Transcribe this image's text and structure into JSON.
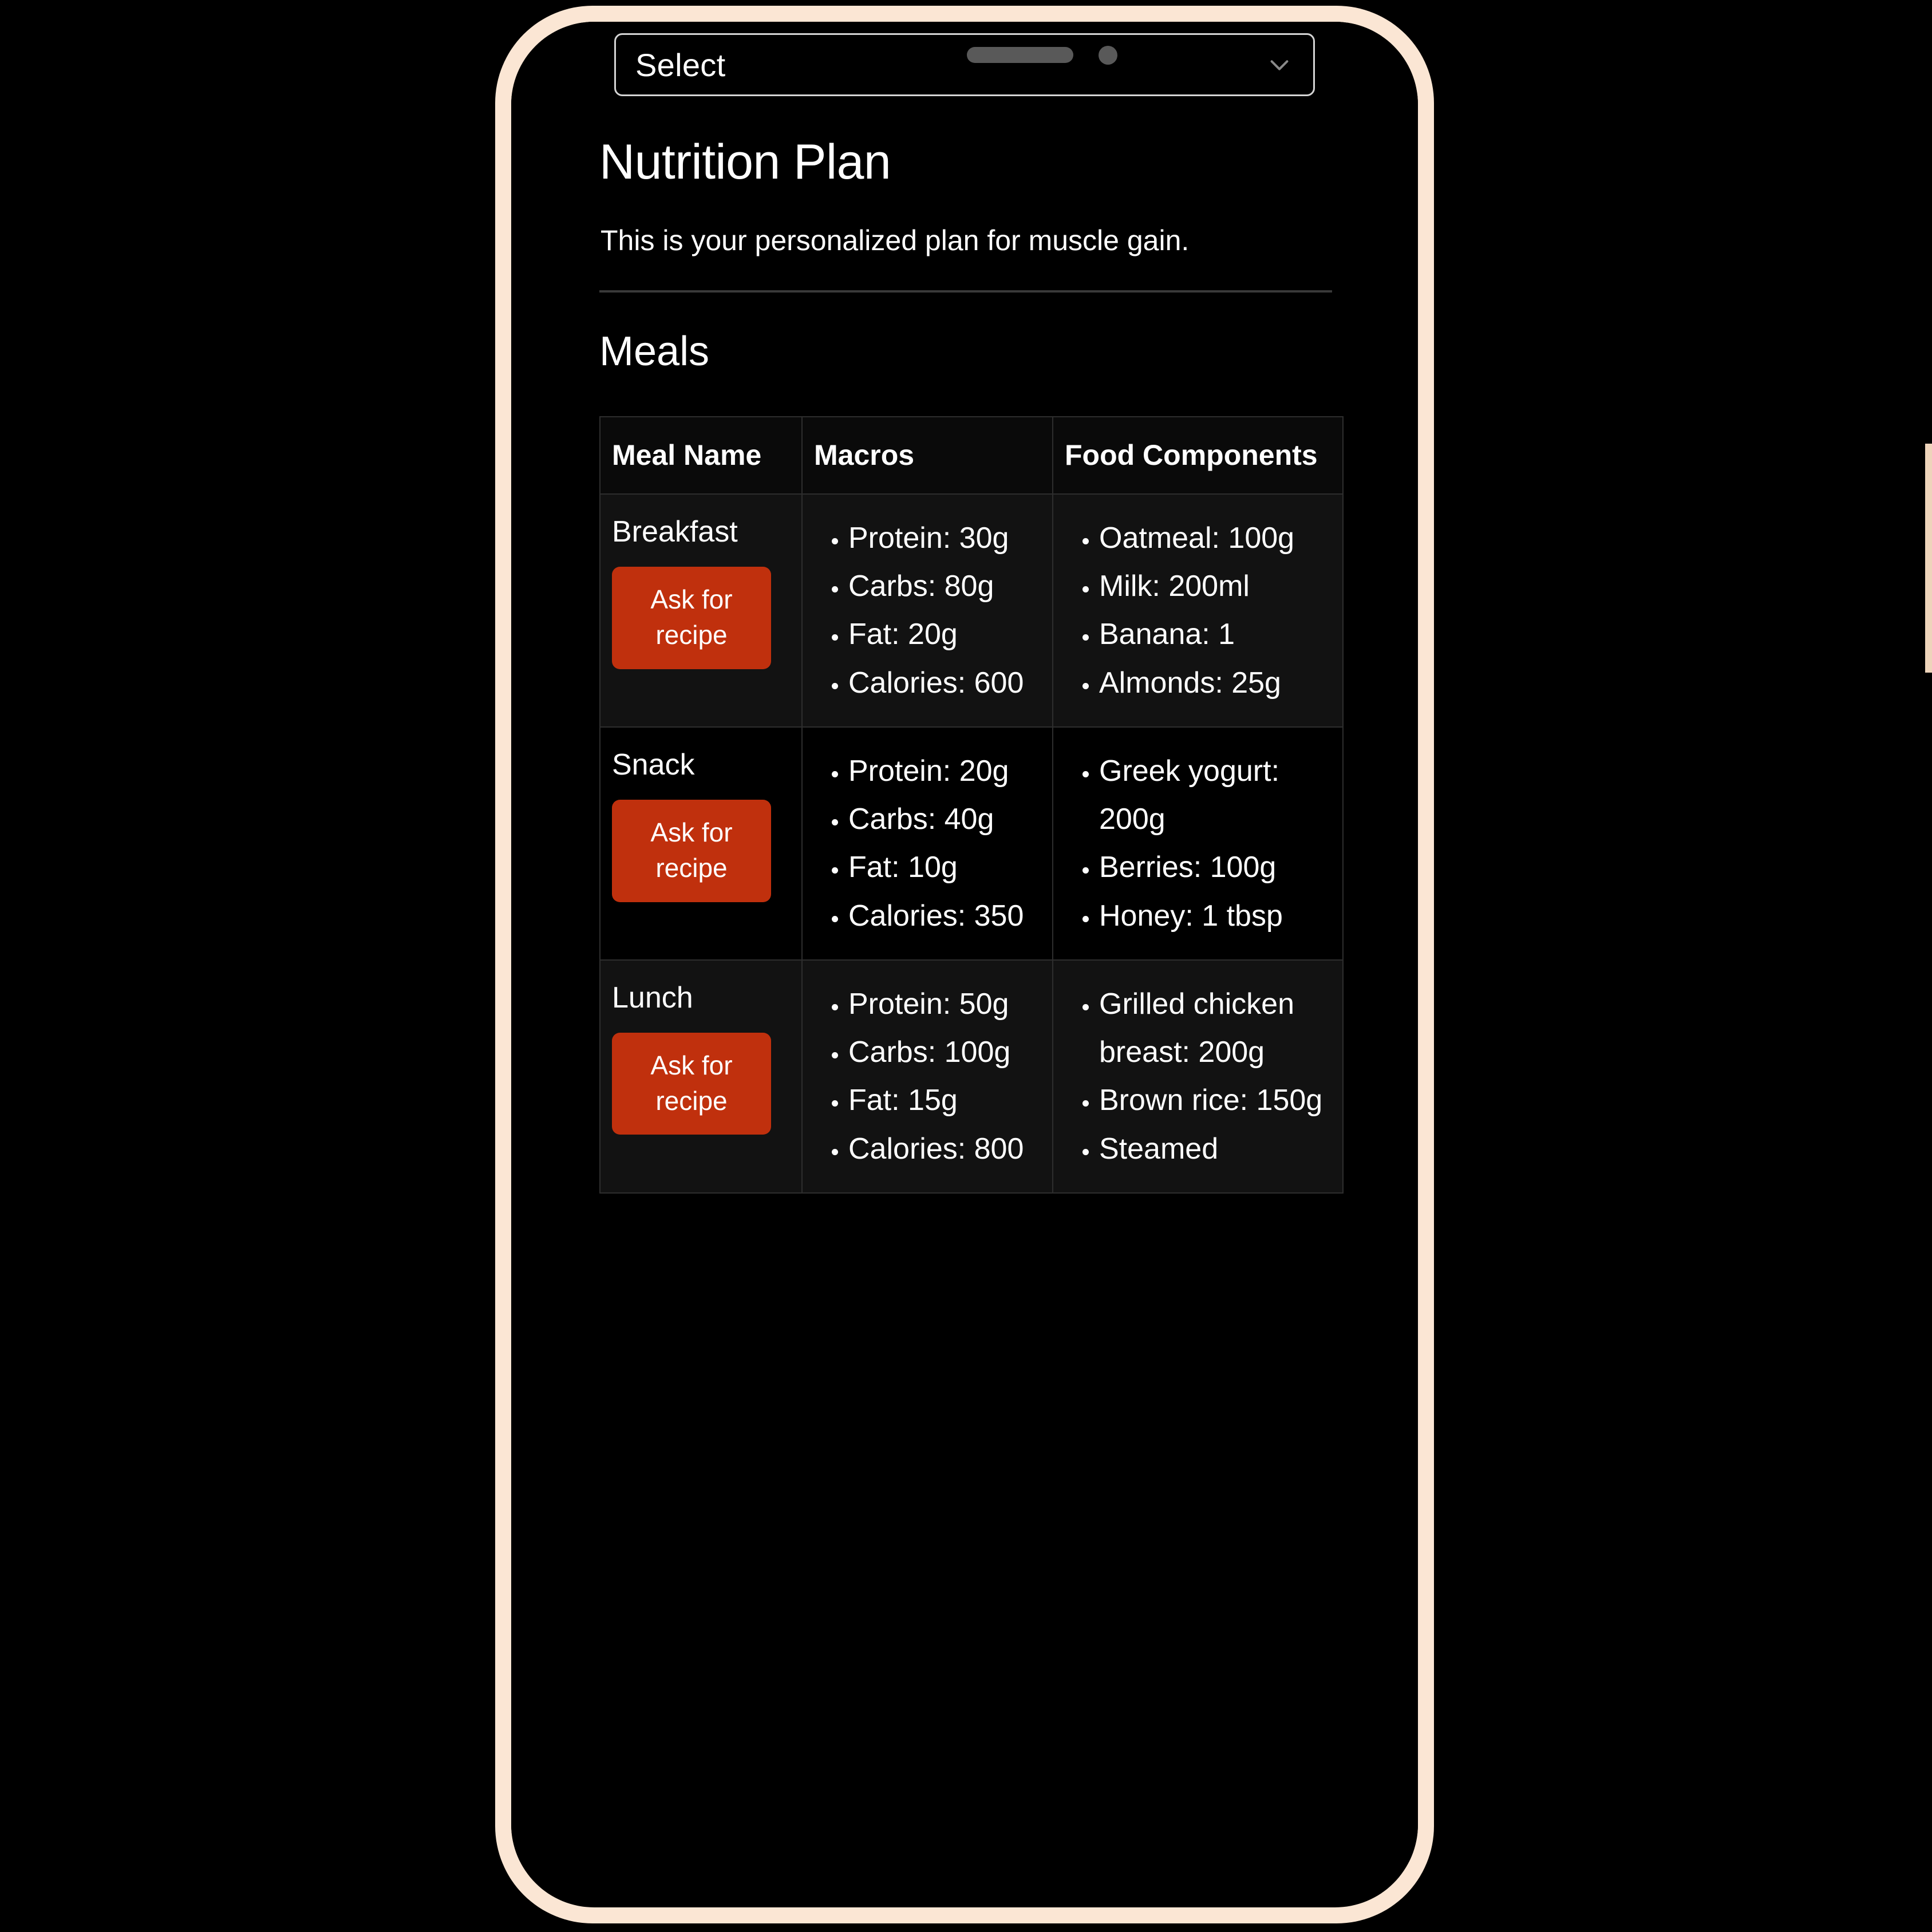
{
  "device": {
    "frame_color": "#fbe6d4",
    "button_color": "#eed4bb",
    "hardware": {
      "speaker_grille": "speaker-grille",
      "front_camera": "front-camera-dot"
    },
    "side_buttons": [
      {
        "name": "silence-switch"
      },
      {
        "name": "volume-up-button"
      },
      {
        "name": "volume-down-button"
      },
      {
        "name": "power-button"
      }
    ]
  },
  "select": {
    "label": "Select",
    "icon": "chevron-down-icon"
  },
  "header": {
    "title": "Nutrition Plan",
    "subtitle": "This is your personalized plan for muscle gain."
  },
  "section": {
    "heading": "Meals"
  },
  "table": {
    "columns": [
      "Meal Name",
      "Macros",
      "Food Components"
    ],
    "button_label": "Ask for recipe",
    "accent_color": "#c0300d",
    "rows": [
      {
        "meal": "Breakfast",
        "macros": [
          "Protein: 30g",
          "Carbs: 80g",
          "Fat: 20g",
          "Calories: 600"
        ],
        "foods": [
          "Oatmeal: 100g",
          "Milk: 200ml",
          "Banana: 1",
          "Almonds: 25g"
        ]
      },
      {
        "meal": "Snack",
        "macros": [
          "Protein: 20g",
          "Carbs: 40g",
          "Fat: 10g",
          "Calories: 350"
        ],
        "foods": [
          "Greek yogurt: 200g",
          "Berries: 100g",
          "Honey: 1 tbsp"
        ]
      },
      {
        "meal": "Lunch",
        "macros": [
          "Protein: 50g",
          "Carbs: 100g",
          "Fat: 15g",
          "Calories: 800"
        ],
        "foods": [
          "Grilled chicken breast: 200g",
          "Brown rice: 150g",
          "Steamed"
        ]
      }
    ]
  }
}
